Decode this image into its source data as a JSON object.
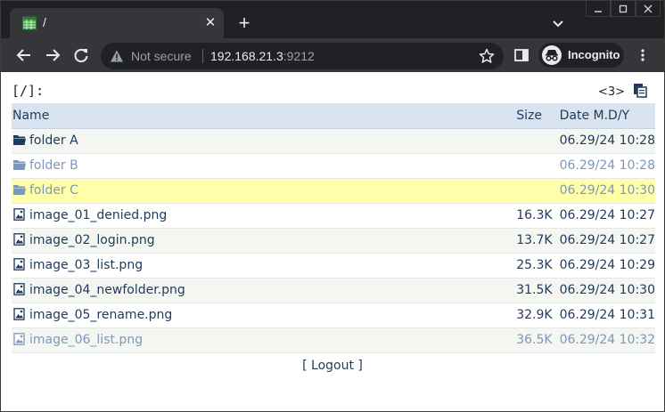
{
  "tab": {
    "title": "/",
    "favicon": "spreadsheet-icon"
  },
  "toolbar": {
    "security_label": "Not secure",
    "url_host": "192.168.21.3",
    "url_port": ":9212",
    "incognito_label": "Incognito"
  },
  "page": {
    "path": "[/]:",
    "count": "<3>",
    "columns": {
      "name": "Name",
      "size": "Size",
      "date": "Date M.D/Y"
    },
    "rows": [
      {
        "name": "folder A",
        "size": "",
        "date": "06.29/24 10:28",
        "type": "folder",
        "style": "norm",
        "bg": "odd"
      },
      {
        "name": "folder B",
        "size": "",
        "date": "06.29/24 10:28",
        "type": "folder",
        "style": "dim",
        "bg": "even"
      },
      {
        "name": "folder C",
        "size": "",
        "date": "06.29/24 10:30",
        "type": "folder",
        "style": "dim",
        "bg": "highlight"
      },
      {
        "name": "image_01_denied.png",
        "size": "16.3K",
        "date": "06.29/24 10:27",
        "type": "image",
        "style": "norm",
        "bg": "even"
      },
      {
        "name": "image_02_login.png",
        "size": "13.7K",
        "date": "06.29/24 10:27",
        "type": "image",
        "style": "norm",
        "bg": "odd"
      },
      {
        "name": "image_03_list.png",
        "size": "25.3K",
        "date": "06.29/24 10:29",
        "type": "image",
        "style": "norm",
        "bg": "even"
      },
      {
        "name": "image_04_newfolder.png",
        "size": "31.5K",
        "date": "06.29/24 10:30",
        "type": "image",
        "style": "norm",
        "bg": "odd"
      },
      {
        "name": "image_05_rename.png",
        "size": "32.9K",
        "date": "06.29/24 10:31",
        "type": "image",
        "style": "norm",
        "bg": "even"
      },
      {
        "name": "image_06_list.png",
        "size": "36.5K",
        "date": "06.29/24 10:32",
        "type": "image",
        "style": "dim",
        "bg": "odd"
      }
    ],
    "logout_label": "[ Logout ]"
  },
  "colors": {
    "header_bg": "#dae4f1",
    "highlight_bg": "#ffffaa",
    "text": "#1f3a5a",
    "dim_text": "#7f97b8"
  }
}
